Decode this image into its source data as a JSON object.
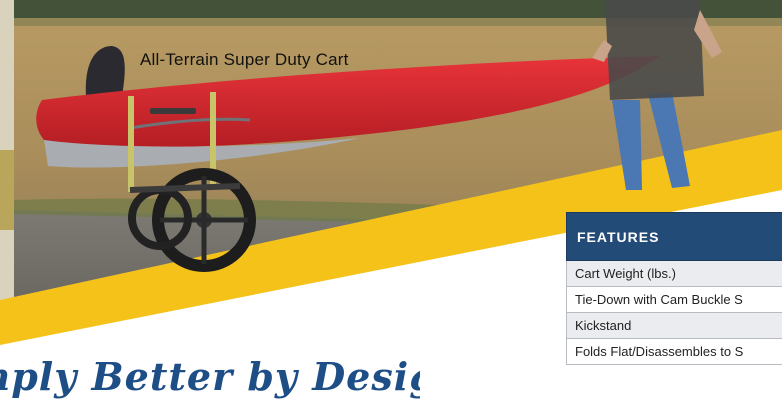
{
  "photo": {
    "caption": "All-Terrain Super Duty Cart",
    "description_icon": "kayak-cart-photo"
  },
  "tagline": {
    "text": "mply Better by Design™"
  },
  "features_table": {
    "header": "FEATURES",
    "rows": [
      {
        "label": "Cart Weight (lbs.)"
      },
      {
        "label": "Tie-Down with Cam Buckle S"
      },
      {
        "label": "Kickstand"
      },
      {
        "label": "Folds Flat/Disassembles to S"
      }
    ]
  },
  "colors": {
    "accent_yellow": "#f5c21a",
    "table_header": "#234b78",
    "tagline_blue": "#1e4e86",
    "kayak_red": "#d8262c"
  }
}
